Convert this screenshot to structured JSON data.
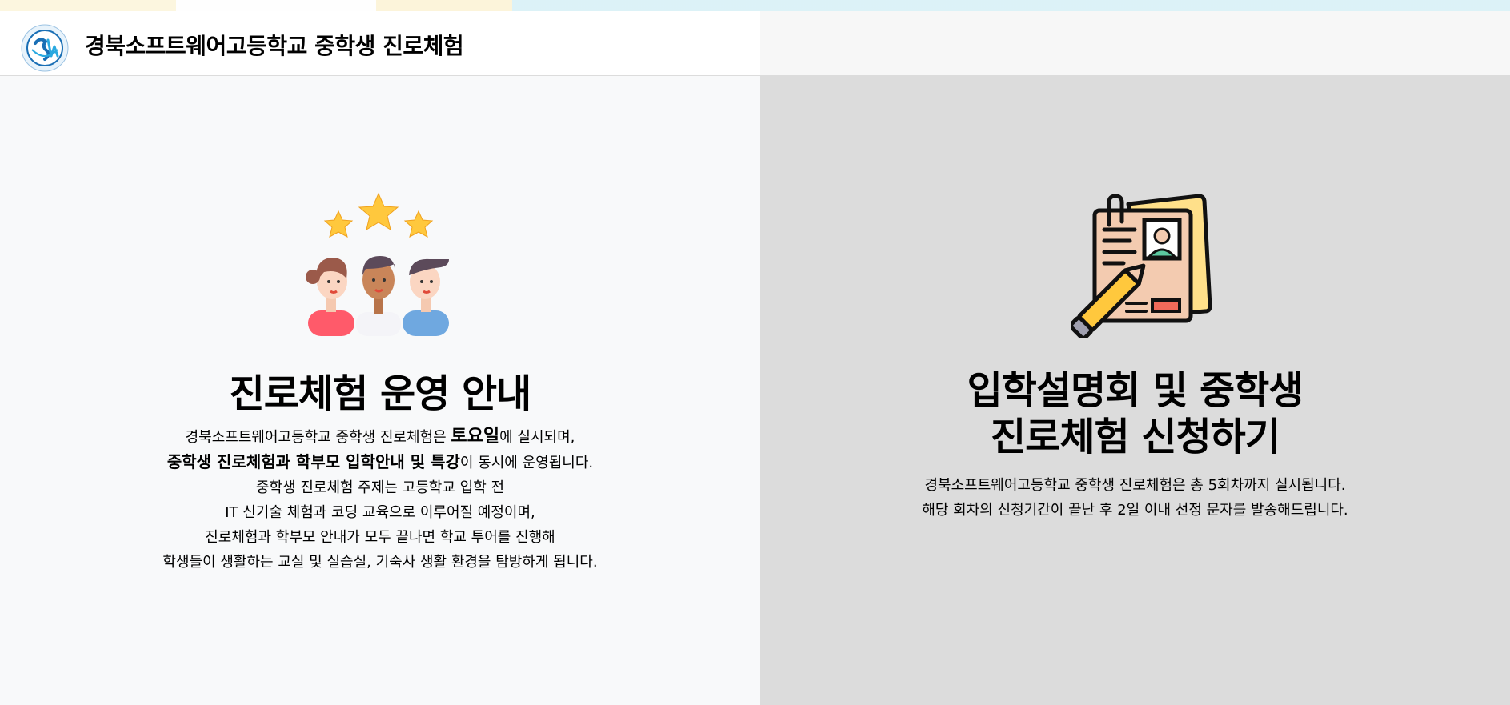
{
  "header": {
    "title": "경북소프트웨어고등학교 중학생 진로체험",
    "logo_icon": "school-logo-icon"
  },
  "left_panel": {
    "icon": "people-stars-icon",
    "heading": "진로체험 운영 안내",
    "line1_a": "경북소프트웨어고등학교 중학생 진로체험은 ",
    "line1_b": "토요일",
    "line1_c": "에 실시되며,",
    "line2_a": "중학생 진로체험과 학부모 입학안내 및 특강",
    "line2_b": "이 동시에 운영됩니다.",
    "line3": "중학생 진로체험 주제는 고등학교 입학 전",
    "line4": "IT 신기술 체험과 코딩 교육으로 이루어질 예정이며,",
    "line5": "진로체험과 학부모 안내가 모두 끝나면 학교 투어를 진행해",
    "line6": "학생들이 생활하는 교실 및 실습실, 기숙사 생활 환경을 탐방하게 됩니다."
  },
  "right_panel": {
    "icon": "application-form-icon",
    "heading_line1": "입학설명회 및 중학생",
    "heading_line2": "진로체험 신청하기",
    "line1": "경북소프트웨어고등학교 중학생 진로체험은 총 5회차까지 실시됩니다.",
    "line2": "해당 회차의 신청기간이 끝난 후 2일 이내 선정 문자를 발송해드립니다."
  },
  "colors": {
    "left_bg": "#f8f9fa",
    "right_bg": "#dcdcdc",
    "header_bg": "#ffffff"
  }
}
